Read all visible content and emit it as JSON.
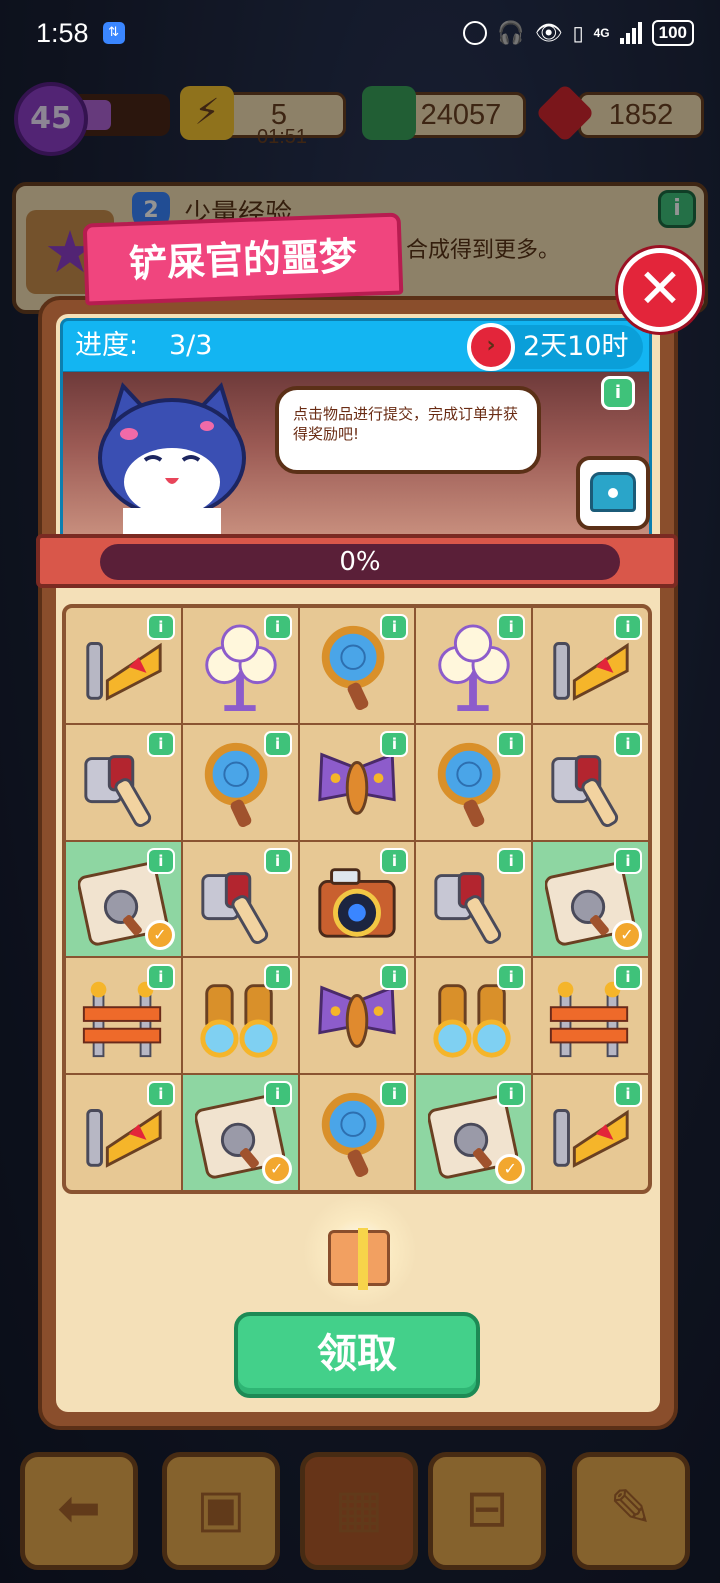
{
  "status_bar": {
    "time": "1:58",
    "battery": "100",
    "network": "4G"
  },
  "hud": {
    "level": "45",
    "level_progress": 0.4,
    "energy": "5",
    "energy_timer": "01:51",
    "cash": "24057",
    "gems": "1852"
  },
  "task_panel": {
    "rank": "2",
    "title": "少量经验",
    "description": "合成得到更多。"
  },
  "event": {
    "title": "铲屎官的噩梦",
    "progress_label": "进度:",
    "progress_value": "3/3",
    "time_left": "2天10时",
    "hint": "点击物品进行提交，完成订单并获得奖励吧!",
    "completion_text": "0%",
    "completion": 0,
    "claim_label": "领取"
  },
  "grid": [
    [
      "sign",
      "lamp",
      "magnifier",
      "lamp",
      "sign"
    ],
    [
      "flashlight",
      "magnifier",
      "moth",
      "magnifier",
      "flashlight"
    ],
    [
      "evidence-bag",
      "flashlight",
      "camera",
      "flashlight",
      "evidence-bag"
    ],
    [
      "barrier",
      "binoculars",
      "moth",
      "binoculars",
      "barrier"
    ],
    [
      "sign",
      "evidence-bag",
      "magnifier",
      "evidence-bag",
      "sign"
    ]
  ],
  "grid_done": [
    [
      false,
      false,
      false,
      false,
      false
    ],
    [
      false,
      false,
      false,
      false,
      false
    ],
    [
      true,
      false,
      false,
      false,
      true
    ],
    [
      false,
      false,
      false,
      false,
      false
    ],
    [
      false,
      true,
      false,
      true,
      false
    ]
  ],
  "icons": {
    "close": "close-icon",
    "timer": "clock-icon",
    "chest": "treasure-chest-icon",
    "info": "info-icon",
    "check": "checkmark-icon"
  },
  "colors": {
    "title_ribbon": "#f0457e",
    "progress_header": "#13b5f2",
    "claim_button": "#43d08a",
    "completed_cell": "#8ed6a2",
    "close_button": "#e3253a"
  }
}
